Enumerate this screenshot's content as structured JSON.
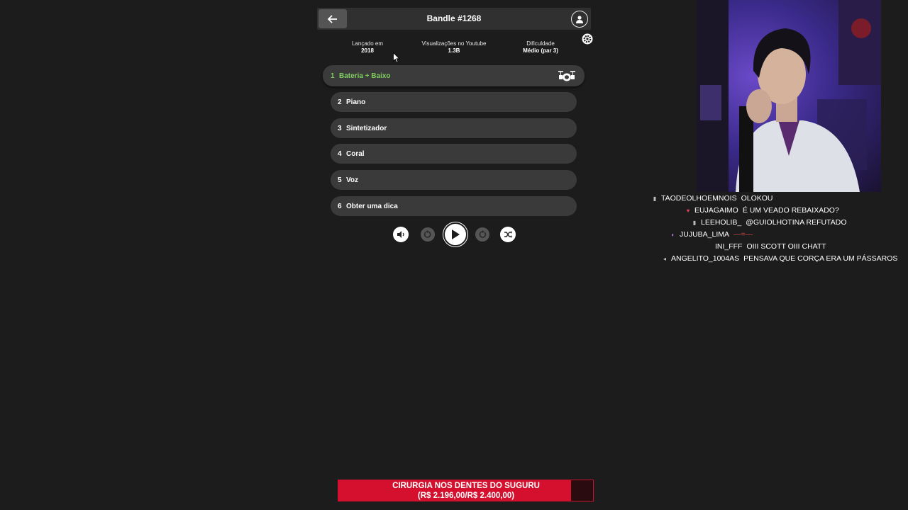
{
  "game": {
    "title": "Bandle #1268",
    "stats": [
      {
        "label": "Lançado em",
        "value": "2018"
      },
      {
        "label": "Visualizações no Youtube",
        "value": "1.3B"
      },
      {
        "label": "Dificuldade",
        "value": "Médio (par 3)"
      }
    ],
    "tracks": [
      {
        "num": "1",
        "label": "Bateria + Baixo"
      },
      {
        "num": "2",
        "label": "Piano"
      },
      {
        "num": "3",
        "label": "Sintetizador"
      },
      {
        "num": "4",
        "label": "Coral"
      },
      {
        "num": "5",
        "label": "Voz"
      },
      {
        "num": "6",
        "label": "Obter uma dica"
      }
    ],
    "active_color": "#7dce5f",
    "icons": [
      "back-arrow-icon",
      "user-icon",
      "gear-icon",
      "drum-kit-icon",
      "volume-icon",
      "rewind-icon",
      "play-icon",
      "forward-icon",
      "shuffle-icon"
    ]
  },
  "chat": {
    "messages": [
      {
        "badge": "▮",
        "user": "TAODEOLHOEMNOIS",
        "text": "OLOKOU"
      },
      {
        "badge": "♥",
        "user": "EUJAGAIMO",
        "text": "É UM VEADO REBAIXADO?"
      },
      {
        "badge": "▮",
        "user": "LEEHOLIB_",
        "text": "@GUIOLHOTINA REFUTADO"
      },
      {
        "badge": "◐",
        "user": "JUJUBA_LIMA",
        "text": "—=—"
      },
      {
        "badge": "",
        "user": "INI_FFF",
        "text": "OIII SCOTT OIII CHATT"
      },
      {
        "badge": "◂",
        "user": "ANGELITO_1004AS",
        "text": "PENSAVA QUE CORÇA ERA UM PÁSSAROS"
      }
    ]
  },
  "goal": {
    "title": "CIRURGIA NOS DENTES DO SUGURU",
    "amount": "(R$ 2.196,00/R$ 2.400,00)",
    "progress": 0.915,
    "color": "#d4102e"
  }
}
